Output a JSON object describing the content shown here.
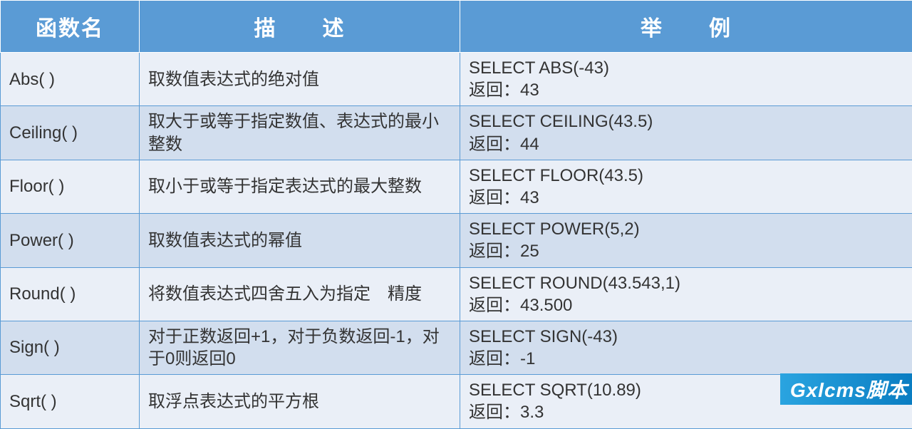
{
  "headers": [
    "函数名",
    "描　　述",
    "举　　例"
  ],
  "rows": [
    {
      "name": "Abs( )",
      "desc": "取数值表达式的绝对值",
      "example": "SELECT ABS(-43)\n返回：43"
    },
    {
      "name": "Ceiling( )",
      "desc": "取大于或等于指定数值、表达式的最小整数",
      "example": "SELECT CEILING(43.5)\n返回：44"
    },
    {
      "name": "Floor( )",
      "desc": "取小于或等于指定表达式的最大整数",
      "example": "SELECT FLOOR(43.5)\n返回：43"
    },
    {
      "name": "Power( )",
      "desc": "取数值表达式的幂值",
      "example": "SELECT POWER(5,2)\n返回：25"
    },
    {
      "name": "Round( )",
      "desc": "将数值表达式四舍五入为指定　精度",
      "example": "SELECT ROUND(43.543,1)\n返回：43.500"
    },
    {
      "name": "Sign( )",
      "desc": "对于正数返回+1，对于负数返回-1，对于0则返回0",
      "example": "SELECT SIGN(-43)\n返回：-1"
    },
    {
      "name": "Sqrt( )",
      "desc": "取浮点表达式的平方根",
      "example": "SELECT SQRT(10.89)\n返回：3.3"
    }
  ],
  "watermark": "Gxlcms脚本",
  "chart_data": {
    "type": "table",
    "title": "SQL 数学函数",
    "columns": [
      "函数名",
      "描述",
      "举例"
    ],
    "data": [
      [
        "Abs( )",
        "取数值表达式的绝对值",
        "SELECT ABS(-43) 返回：43"
      ],
      [
        "Ceiling( )",
        "取大于或等于指定数值、表达式的最小整数",
        "SELECT CEILING(43.5) 返回：44"
      ],
      [
        "Floor( )",
        "取小于或等于指定表达式的最大整数",
        "SELECT FLOOR(43.5) 返回：43"
      ],
      [
        "Power( )",
        "取数值表达式的幂值",
        "SELECT POWER(5,2) 返回：25"
      ],
      [
        "Round( )",
        "将数值表达式四舍五入为指定精度",
        "SELECT ROUND(43.543,1) 返回：43.500"
      ],
      [
        "Sign( )",
        "对于正数返回+1，对于负数返回-1，对于0则返回0",
        "SELECT SIGN(-43) 返回：-1"
      ],
      [
        "Sqrt( )",
        "取浮点表达式的平方根",
        "SELECT SQRT(10.89) 返回：3.3"
      ]
    ]
  }
}
